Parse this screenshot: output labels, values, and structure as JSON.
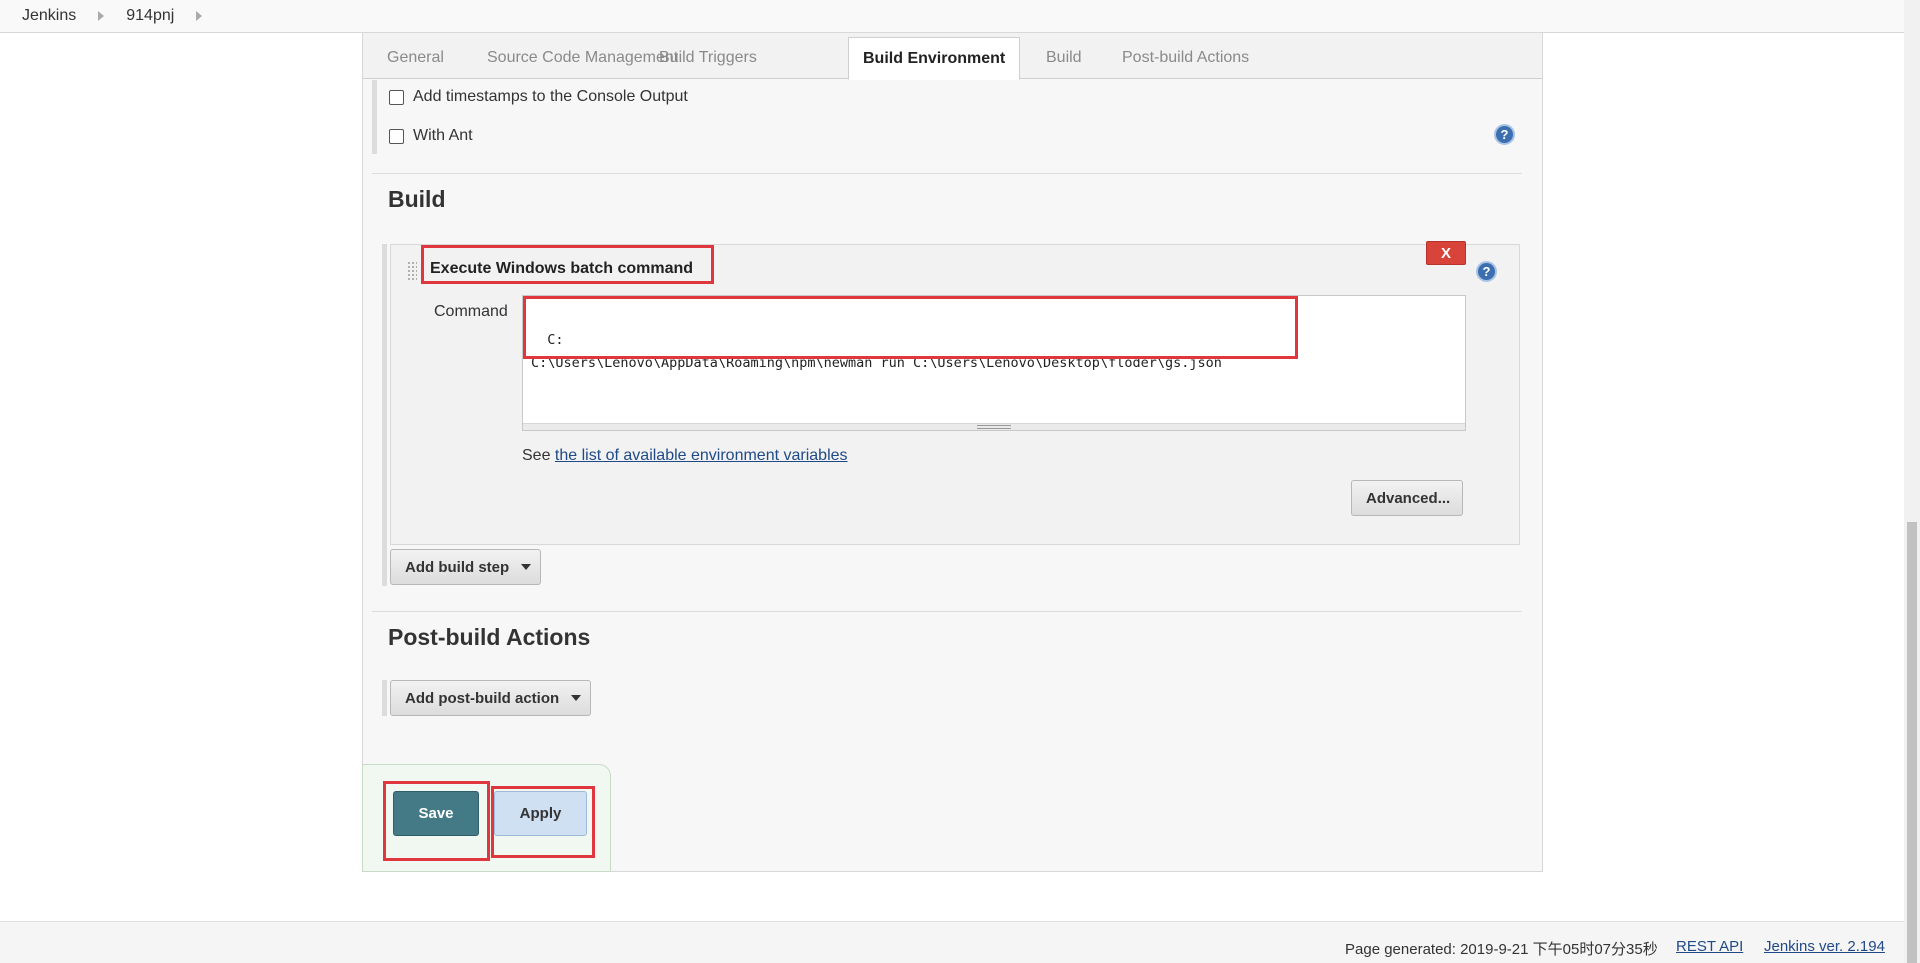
{
  "breadcrumb": {
    "items": [
      "Jenkins",
      "914pnj"
    ]
  },
  "tabs": [
    "General",
    "Source Code Management",
    "Build Triggers",
    "Build Environment",
    "Build",
    "Post-build Actions"
  ],
  "active_tab": "Build Environment",
  "build_environment": {
    "options": [
      "Add timestamps to the Console Output",
      "With Ant"
    ]
  },
  "build": {
    "title": "Build",
    "step_title": "Execute Windows batch command",
    "delete_label": "X",
    "command_label": "Command",
    "command_value": "C:\nC:\\Users\\Lenovo\\AppData\\Roaming\\npm\\newman run C:\\Users\\Lenovo\\Desktop\\floder\\gs.json",
    "env_prefix": "See ",
    "env_link": "the list of available environment variables",
    "advanced_label": "Advanced...",
    "add_step_label": "Add build step"
  },
  "post_build": {
    "title": "Post-build Actions",
    "add_action_label": "Add post-build action"
  },
  "actions": {
    "save_label": "Save",
    "apply_label": "Apply"
  },
  "footer": {
    "generated": "Page generated: 2019-9-21 下午05时07分35秒",
    "rest_api": "REST API",
    "version": "Jenkins ver. 2.194"
  },
  "colors": {
    "annotation": "#e0373e",
    "save": "#437a86",
    "apply": "#cfe0f2"
  }
}
